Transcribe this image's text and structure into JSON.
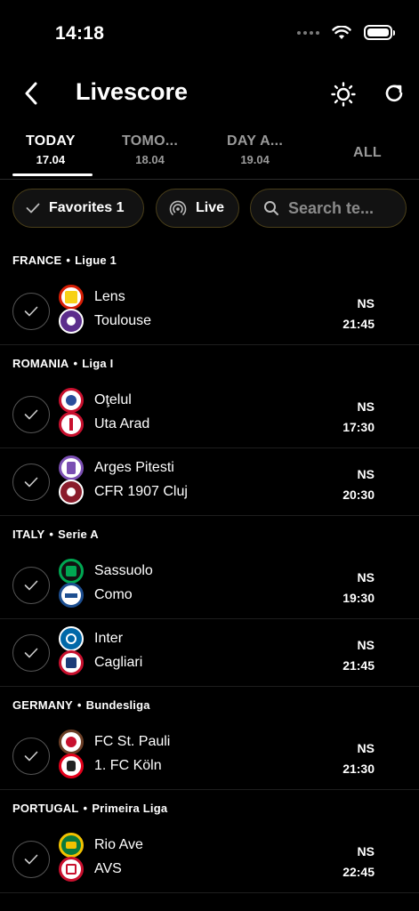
{
  "status_bar": {
    "time": "14:18"
  },
  "header": {
    "title": "Livescore"
  },
  "tabs": [
    {
      "name": "TODAY",
      "date": "17.04"
    },
    {
      "name": "TOMO...",
      "date": "18.04"
    },
    {
      "name": "DAY A...",
      "date": "19.04"
    },
    {
      "name": "ALL",
      "date": ""
    }
  ],
  "filters": {
    "favorites_label": "Favorites 1",
    "live_label": "Live",
    "search_placeholder": "Search te..."
  },
  "leagues": [
    {
      "country": "FRANCE",
      "name": "Ligue 1"
    },
    {
      "country": "ROMANIA",
      "name": "Liga I"
    },
    {
      "country": "ITALY",
      "name": "Serie A"
    },
    {
      "country": "GERMANY",
      "name": "Bundesliga"
    },
    {
      "country": "PORTUGAL",
      "name": "Primeira Liga"
    }
  ],
  "matches": [
    {
      "home": "Lens",
      "away": "Toulouse",
      "status": "NS",
      "time": "21:45"
    },
    {
      "home": "Oţelul",
      "away": "Uta Arad",
      "status": "NS",
      "time": "17:30"
    },
    {
      "home": "Arges Pitesti",
      "away": "CFR 1907 Cluj",
      "status": "NS",
      "time": "20:30"
    },
    {
      "home": "Sassuolo",
      "away": "Como",
      "status": "NS",
      "time": "19:30"
    },
    {
      "home": "Inter",
      "away": "Cagliari",
      "status": "NS",
      "time": "21:45"
    },
    {
      "home": "FC St. Pauli",
      "away": "1. FC Köln",
      "status": "NS",
      "time": "21:30"
    },
    {
      "home": "Rio Ave",
      "away": "AVS",
      "status": "NS",
      "time": "22:45"
    }
  ],
  "colors": {
    "background": "#000000",
    "chip_border": "#4a3f1a",
    "muted_text": "#9a9a9a"
  }
}
